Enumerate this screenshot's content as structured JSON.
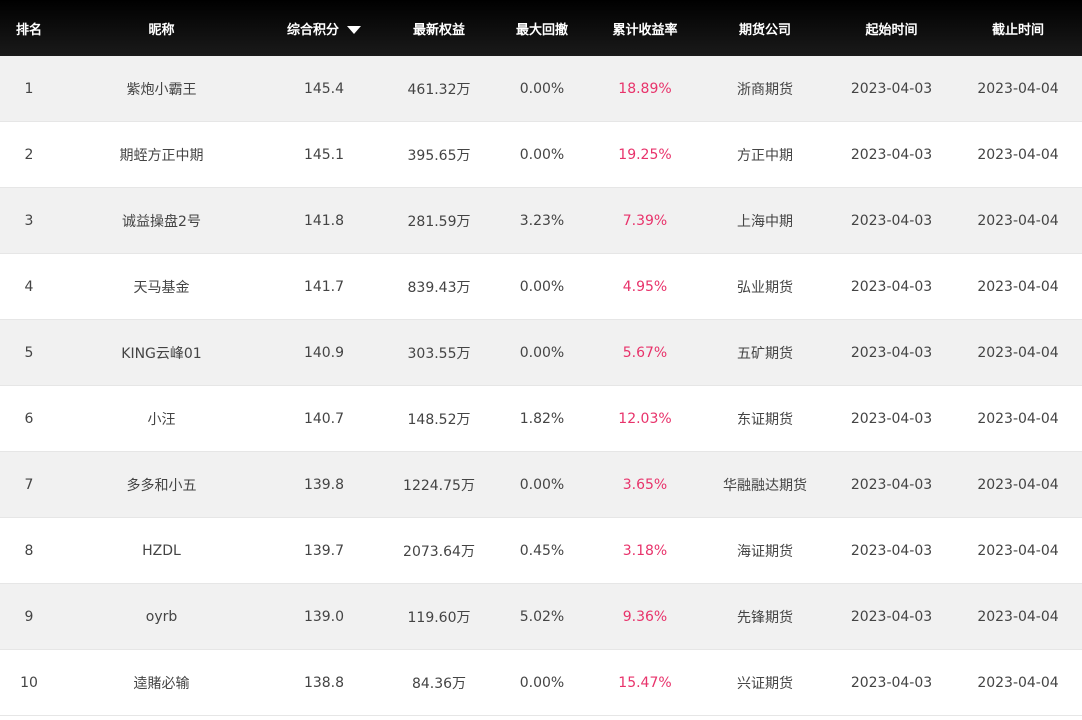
{
  "headers": {
    "rank": "排名",
    "name": "昵称",
    "score": "综合积分",
    "equity": "最新权益",
    "drawdown": "最大回撤",
    "return": "累计收益率",
    "company": "期货公司",
    "start": "起始时间",
    "end": "截止时间"
  },
  "sort_icon": "sort-desc-triangle-icon",
  "colors": {
    "header_bg": "#000000",
    "return_text": "#e8336b",
    "row_alt": "#f1f1f1"
  },
  "rows": [
    {
      "rank": "1",
      "name": "紫炮小霸王",
      "score": "145.4",
      "equity": "461.32万",
      "drawdown": "0.00%",
      "return": "18.89%",
      "company": "浙商期货",
      "start": "2023-04-03",
      "end": "2023-04-04"
    },
    {
      "rank": "2",
      "name": "期蛭方正中期",
      "score": "145.1",
      "equity": "395.65万",
      "drawdown": "0.00%",
      "return": "19.25%",
      "company": "方正中期",
      "start": "2023-04-03",
      "end": "2023-04-04"
    },
    {
      "rank": "3",
      "name": "诚益操盘2号",
      "score": "141.8",
      "equity": "281.59万",
      "drawdown": "3.23%",
      "return": "7.39%",
      "company": "上海中期",
      "start": "2023-04-03",
      "end": "2023-04-04"
    },
    {
      "rank": "4",
      "name": "天马基金",
      "score": "141.7",
      "equity": "839.43万",
      "drawdown": "0.00%",
      "return": "4.95%",
      "company": "弘业期货",
      "start": "2023-04-03",
      "end": "2023-04-04"
    },
    {
      "rank": "5",
      "name": "KING云峰01",
      "score": "140.9",
      "equity": "303.55万",
      "drawdown": "0.00%",
      "return": "5.67%",
      "company": "五矿期货",
      "start": "2023-04-03",
      "end": "2023-04-04"
    },
    {
      "rank": "6",
      "name": "小汪",
      "score": "140.7",
      "equity": "148.52万",
      "drawdown": "1.82%",
      "return": "12.03%",
      "company": "东证期货",
      "start": "2023-04-03",
      "end": "2023-04-04"
    },
    {
      "rank": "7",
      "name": "多多和小五",
      "score": "139.8",
      "equity": "1224.75万",
      "drawdown": "0.00%",
      "return": "3.65%",
      "company": "华融融达期货",
      "start": "2023-04-03",
      "end": "2023-04-04"
    },
    {
      "rank": "8",
      "name": "HZDL",
      "score": "139.7",
      "equity": "2073.64万",
      "drawdown": "0.45%",
      "return": "3.18%",
      "company": "海证期货",
      "start": "2023-04-03",
      "end": "2023-04-04"
    },
    {
      "rank": "9",
      "name": "oyrb",
      "score": "139.0",
      "equity": "119.60万",
      "drawdown": "5.02%",
      "return": "9.36%",
      "company": "先锋期货",
      "start": "2023-04-03",
      "end": "2023-04-04"
    },
    {
      "rank": "10",
      "name": "逵賭必输",
      "score": "138.8",
      "equity": "84.36万",
      "drawdown": "0.00%",
      "return": "15.47%",
      "company": "兴证期货",
      "start": "2023-04-03",
      "end": "2023-04-04"
    }
  ]
}
